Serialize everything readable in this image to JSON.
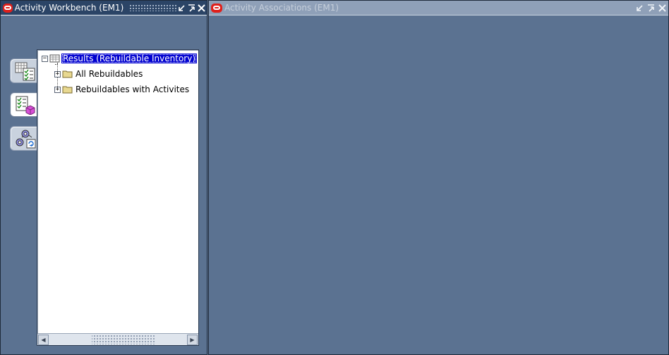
{
  "left_window": {
    "title": "Activity Workbench (EM1)",
    "controls": [
      "minimize-icon",
      "maximize-icon",
      "close-icon"
    ]
  },
  "right_window": {
    "title": "Activity Associations (EM1)",
    "controls": [
      "minimize-icon",
      "maximize-icon",
      "close-icon"
    ]
  },
  "toolbar": {
    "buttons": [
      {
        "name": "results-view-button",
        "icon": "grid-checklist-icon"
      },
      {
        "name": "activities-view-button",
        "icon": "checklist-box-icon",
        "active": true
      },
      {
        "name": "associations-view-button",
        "icon": "gears-refresh-icon"
      }
    ]
  },
  "tree": {
    "root": {
      "label": "Results (Rebuildable Inventory)",
      "expanded": true,
      "selected": true
    },
    "children": [
      {
        "label": "All Rebuildables",
        "expander": "+"
      },
      {
        "label": "Rebuildables with Activites",
        "expander": "+"
      }
    ],
    "root_expander": "−"
  },
  "colors": {
    "desktop": "#5b7291",
    "active_titlebar": "#2b4466",
    "inactive_titlebar": "#8fa0b8",
    "selection": "#0000d0",
    "oracle_red": "#e0201b",
    "folder": "#e8d890"
  }
}
